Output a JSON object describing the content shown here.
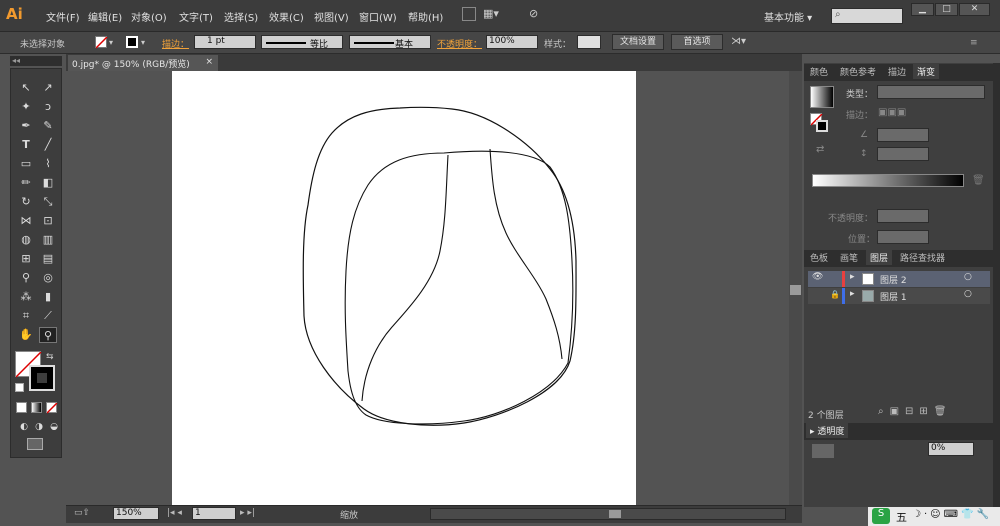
{
  "app": {
    "logo": "Ai"
  },
  "menu": {
    "items": [
      "文件(F)",
      "编辑(E)",
      "对象(O)",
      "文字(T)",
      "选择(S)",
      "效果(C)",
      "视图(V)",
      "窗口(W)",
      "帮助(H)"
    ],
    "workspace": "基本功能",
    "search_placeholder": ""
  },
  "control": {
    "selection": "未选择对象",
    "stroke_label": "描边：",
    "stroke_weight": "1 pt",
    "profile_label": "等比",
    "brush_label": "基本",
    "opacity_label": "不透明度：",
    "opacity_value": "100%",
    "style_label": "样式：",
    "doc_setup": "文档设置",
    "preferences": "首选项"
  },
  "document": {
    "tab_title": "0.jpg* @ 150% (RGB/预览)",
    "close": "×"
  },
  "status": {
    "zoom": "150%",
    "page": "1",
    "tool": "缩放"
  },
  "gradient_panel": {
    "tabs": [
      "颜色",
      "颜色参考",
      "描边",
      "渐变"
    ],
    "type_label": "类型：",
    "stroke_label": "描边：",
    "opacity_label": "不透明度：",
    "position_label": "位置："
  },
  "layers_panel": {
    "tabs": [
      "色板",
      "画笔",
      "图层",
      "路径查找器"
    ],
    "layers": [
      {
        "name": "图层 2",
        "color": "#e84040",
        "selected": true
      },
      {
        "name": "图层 1",
        "color": "#3f6ee8",
        "selected": false
      }
    ],
    "count": "2 个图层"
  },
  "transparency_panel": {
    "tab": "透明度",
    "value": "0%"
  },
  "taskbar": {
    "label": "五"
  },
  "colors": {
    "accent": "#f29a2e",
    "panel": "#3f3f3f",
    "selection_row": "#5b6273"
  }
}
